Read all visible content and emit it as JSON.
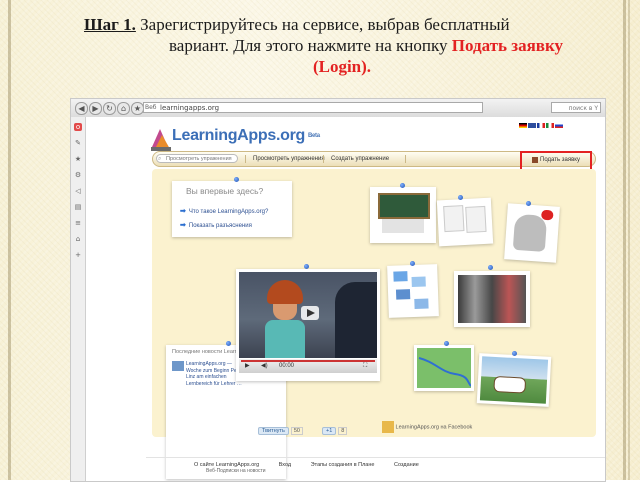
{
  "slide": {
    "step_label": "Шаг 1.",
    "line1": " Зарегистрируйтесь на сервисе, выбрав бесплатный",
    "line2_prefix": "вариант. Для этого нажмите на кнопку ",
    "highlight1": "Подать заявку",
    "highlight2": "(Login)."
  },
  "browser": {
    "address": "learningapps.org",
    "site_tag": "Веб",
    "search_placeholder": "поиск в Y"
  },
  "site": {
    "logo": "LearningApps.org",
    "beta": "Beta",
    "search_placeholder": "Просмотреть упражнения",
    "nav": [
      "Просмотреть упражнения",
      "Создать упражнение"
    ],
    "login_label": "Подать заявку",
    "welcome_title": "Вы впервые здесь?",
    "welcome_items": [
      "Что такое LearningApps.org?",
      "Показать разъяснения"
    ],
    "news_heading": "Последние новости LearningApps",
    "news_text": "LearningApps.org — Woche zum Beginn Peter Linz am einfachen Lernbereich für Lehrer …",
    "news_footer": "Веб-Подписки на новости",
    "video_time": "00:00",
    "tweet_label": "Твитнуть",
    "tweet_count": "50",
    "like_count": "8",
    "footer_links": [
      "О сайте LearningApps.org",
      "Вход",
      "Этапы создания в Плане",
      "Создание"
    ],
    "right_social": "LearningApps.org на Facebook"
  },
  "colors": {
    "highlight": "#e32222",
    "logo": "#3c6fb7",
    "canvas": "#fbf2cf"
  }
}
